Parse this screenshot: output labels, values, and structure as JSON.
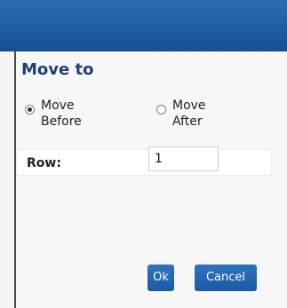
{
  "dialog": {
    "title": "",
    "heading": "Move to"
  },
  "position": {
    "options": [
      {
        "label": "Move\nBefore",
        "checked": true
      },
      {
        "label": "Move\nAfter",
        "checked": false
      }
    ]
  },
  "row": {
    "label": "Row:",
    "value": "1"
  },
  "buttons": {
    "ok": "Ok",
    "cancel": "Cancel"
  },
  "colors": {
    "titlebar": "#1e5aa0",
    "heading": "#1e3f72",
    "button": "#2463ad"
  }
}
